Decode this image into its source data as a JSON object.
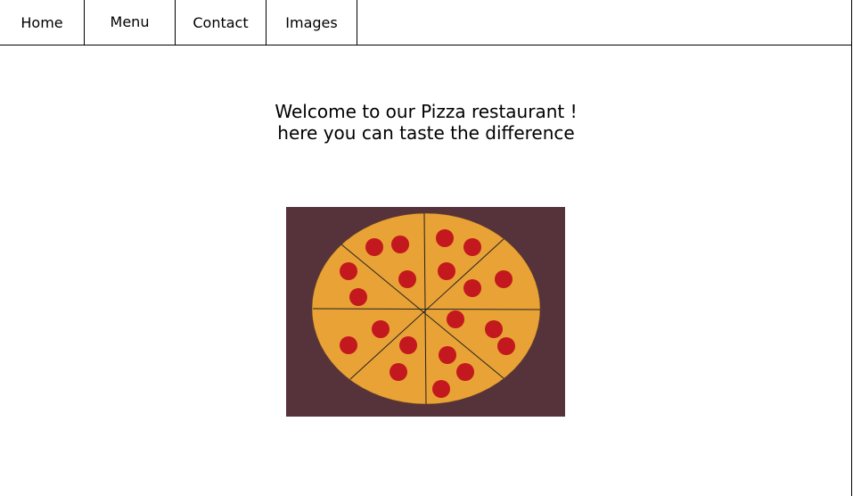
{
  "nav": {
    "items": [
      {
        "label": "Home"
      },
      {
        "label": "Menu"
      },
      {
        "label": "Contact"
      },
      {
        "label": "Images"
      }
    ]
  },
  "hero": {
    "line1": "Welcome to our Pizza restaurant !",
    "line2": "here you can taste the difference"
  },
  "image": {
    "subject": "pepperoni-pizza",
    "slices": 8,
    "background_color": "#56323a",
    "crust_color": "#e9a236",
    "pepperoni_color": "#c3181d"
  }
}
